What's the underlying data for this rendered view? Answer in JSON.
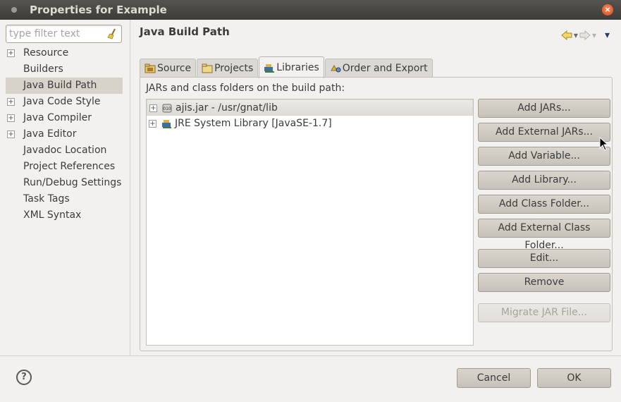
{
  "window": {
    "title": "Properties for Example"
  },
  "filter": {
    "placeholder": "type filter text",
    "value": ""
  },
  "tree": {
    "items": [
      {
        "label": "Resource",
        "expandable": true
      },
      {
        "label": "Builders",
        "expandable": false
      },
      {
        "label": "Java Build Path",
        "expandable": false,
        "selected": true
      },
      {
        "label": "Java Code Style",
        "expandable": true
      },
      {
        "label": "Java Compiler",
        "expandable": true
      },
      {
        "label": "Java Editor",
        "expandable": true
      },
      {
        "label": "Javadoc Location",
        "expandable": false
      },
      {
        "label": "Project References",
        "expandable": false
      },
      {
        "label": "Run/Debug Settings",
        "expandable": false
      },
      {
        "label": "Task Tags",
        "expandable": false
      },
      {
        "label": "XML Syntax",
        "expandable": false
      }
    ]
  },
  "page": {
    "title": "Java Build Path"
  },
  "tabs": [
    {
      "label": "Source",
      "icon": "source-folder-icon"
    },
    {
      "label": "Projects",
      "icon": "projects-icon"
    },
    {
      "label": "Libraries",
      "icon": "libraries-icon",
      "active": true
    },
    {
      "label": "Order and Export",
      "icon": "order-export-icon"
    }
  ],
  "libraries": {
    "section_label": "JARs and class folders on the build path:",
    "entries": [
      {
        "label": "ajis.jar - /usr/gnat/lib",
        "icon": "jar-icon"
      },
      {
        "label": "JRE System Library [JavaSE-1.7]",
        "icon": "library-icon"
      }
    ],
    "buttons": {
      "add_jars": "Add JARs...",
      "add_external_jars": "Add External JARs...",
      "add_variable": "Add Variable...",
      "add_library": "Add Library...",
      "add_class_folder": "Add Class Folder...",
      "add_external_class_folder": "Add External Class Folder...",
      "edit": "Edit...",
      "remove": "Remove",
      "migrate_jar": "Migrate JAR File..."
    }
  },
  "footer": {
    "cancel": "Cancel",
    "ok": "OK",
    "help": "?"
  }
}
